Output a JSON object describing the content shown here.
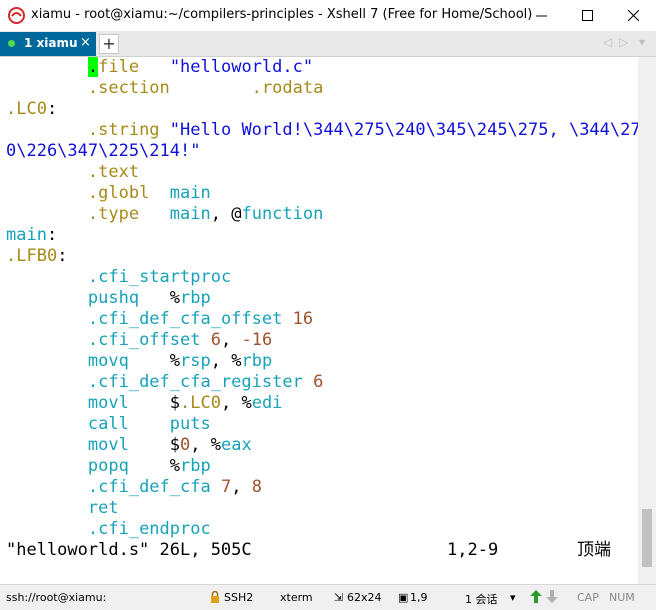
{
  "window": {
    "title": "xiamu - root@xiamu:~/compilers-principles - Xshell 7 (Free for Home/School)"
  },
  "tabs": [
    {
      "label": "1 xiamu",
      "close": "×"
    }
  ],
  "tabbar": {
    "add_label": "+",
    "prev": "◁",
    "next": "▷",
    "menu": "▾"
  },
  "terminal": {
    "lines": [
      [
        {
          "t": "        "
        },
        {
          "t": ".",
          "c": "cursor"
        },
        {
          "t": "file",
          "c": "olive"
        },
        {
          "t": "   "
        },
        {
          "t": "\"helloworld.c\"",
          "c": "blue"
        }
      ],
      [
        {
          "t": "        "
        },
        {
          "t": ".section",
          "c": "olive"
        },
        {
          "t": "        "
        },
        {
          "t": ".rodata",
          "c": "olive"
        }
      ],
      [
        {
          "t": ".LC0",
          "c": "olive"
        },
        {
          "t": ":"
        }
      ],
      [
        {
          "t": "        "
        },
        {
          "t": ".string",
          "c": "olive"
        },
        {
          "t": " "
        },
        {
          "t": "\"Hello World!\\344\\275\\240\\345\\245\\275, \\344\\27",
          "c": "blue"
        }
      ],
      [
        {
          "t": "0\\226\\347\\225\\214!\"",
          "c": "blue"
        }
      ],
      [
        {
          "t": "        "
        },
        {
          "t": ".text",
          "c": "olive"
        }
      ],
      [
        {
          "t": "        "
        },
        {
          "t": ".globl",
          "c": "olive"
        },
        {
          "t": "  "
        },
        {
          "t": "main",
          "c": "cyan"
        }
      ],
      [
        {
          "t": "        "
        },
        {
          "t": ".type",
          "c": "olive"
        },
        {
          "t": "   "
        },
        {
          "t": "main",
          "c": "cyan"
        },
        {
          "t": ", @"
        },
        {
          "t": "function",
          "c": "cyan"
        }
      ],
      [
        {
          "t": "main",
          "c": "cyan"
        },
        {
          "t": ":"
        }
      ],
      [
        {
          "t": ".LFB0",
          "c": "olive"
        },
        {
          "t": ":"
        }
      ],
      [
        {
          "t": "        "
        },
        {
          "t": ".cfi_startproc",
          "c": "cyan"
        }
      ],
      [
        {
          "t": "        "
        },
        {
          "t": "pushq",
          "c": "cyan"
        },
        {
          "t": "   %"
        },
        {
          "t": "rbp",
          "c": "cyan"
        }
      ],
      [
        {
          "t": "        "
        },
        {
          "t": ".cfi_def_cfa_offset",
          "c": "cyan"
        },
        {
          "t": " "
        },
        {
          "t": "16",
          "c": "brown"
        }
      ],
      [
        {
          "t": "        "
        },
        {
          "t": ".cfi_offset",
          "c": "cyan"
        },
        {
          "t": " "
        },
        {
          "t": "6",
          "c": "brown"
        },
        {
          "t": ", "
        },
        {
          "t": "-16",
          "c": "brown"
        }
      ],
      [
        {
          "t": "        "
        },
        {
          "t": "movq",
          "c": "cyan"
        },
        {
          "t": "    %"
        },
        {
          "t": "rsp",
          "c": "cyan"
        },
        {
          "t": ", %"
        },
        {
          "t": "rbp",
          "c": "cyan"
        }
      ],
      [
        {
          "t": "        "
        },
        {
          "t": ".cfi_def_cfa_register",
          "c": "cyan"
        },
        {
          "t": " "
        },
        {
          "t": "6",
          "c": "brown"
        }
      ],
      [
        {
          "t": "        "
        },
        {
          "t": "movl",
          "c": "cyan"
        },
        {
          "t": "    $"
        },
        {
          "t": ".LC0",
          "c": "olive"
        },
        {
          "t": ", %"
        },
        {
          "t": "edi",
          "c": "cyan"
        }
      ],
      [
        {
          "t": "        "
        },
        {
          "t": "call",
          "c": "cyan"
        },
        {
          "t": "    "
        },
        {
          "t": "puts",
          "c": "cyan"
        }
      ],
      [
        {
          "t": "        "
        },
        {
          "t": "movl",
          "c": "cyan"
        },
        {
          "t": "    $"
        },
        {
          "t": "0",
          "c": "brown"
        },
        {
          "t": ", %"
        },
        {
          "t": "eax",
          "c": "cyan"
        }
      ],
      [
        {
          "t": "        "
        },
        {
          "t": "popq",
          "c": "cyan"
        },
        {
          "t": "    %"
        },
        {
          "t": "rbp",
          "c": "cyan"
        }
      ],
      [
        {
          "t": "        "
        },
        {
          "t": ".cfi_def_cfa",
          "c": "cyan"
        },
        {
          "t": " "
        },
        {
          "t": "7",
          "c": "brown"
        },
        {
          "t": ", "
        },
        {
          "t": "8",
          "c": "brown"
        }
      ],
      [
        {
          "t": "        "
        },
        {
          "t": "ret",
          "c": "cyan"
        }
      ],
      [
        {
          "t": "        "
        },
        {
          "t": ".cfi_endproc",
          "c": "cyan"
        }
      ]
    ],
    "vim_status": {
      "file_info": "\"helloworld.s\" 26L, 505C",
      "position": "1,2-9",
      "scroll": "顶端"
    }
  },
  "statusbar": {
    "connection": "ssh://root@xiamu:",
    "protocol": "SSH2",
    "terminal_type": "xterm",
    "size": "62x24",
    "cursor": "1,9",
    "sessions": "1 会话",
    "caps": "CAP",
    "num": "NUM"
  },
  "colors": {
    "cyan": "#17a2b8",
    "olive": "#a68a1a",
    "blue": "#1010d8",
    "brown": "#a0522d",
    "cursor": "#00ff00",
    "tab_active": "#00689a"
  }
}
